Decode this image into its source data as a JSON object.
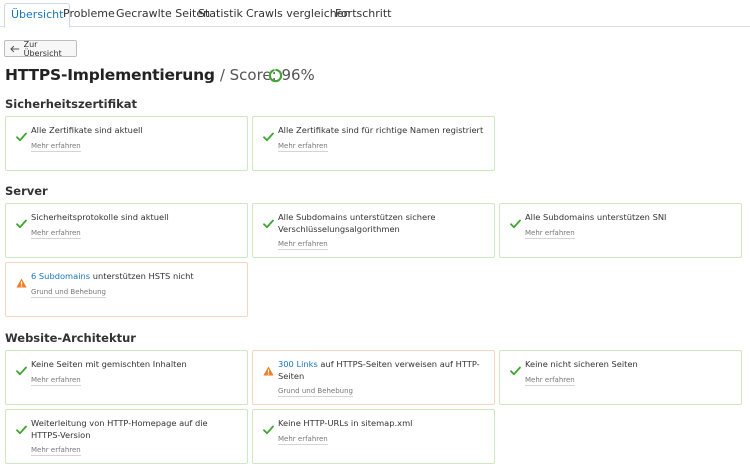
{
  "tabs": [
    "Übersicht",
    "Probleme",
    "Gecrawlte Seiten",
    "Statistik",
    "Crawls vergleichen",
    "Fortschritt"
  ],
  "back_label": "Zur Übersicht",
  "title": "HTTPS-Implementierung",
  "score_text": "/ Score: 96%",
  "score_value": 96,
  "colors": {
    "ok": "#3da530",
    "warn": "#f07e25",
    "link": "#1a75bb"
  },
  "sections": {
    "cert": {
      "title": "Sicherheitszertifikat",
      "cards": [
        {
          "status": "ok",
          "text": "Alle Zertifikate sind aktuell",
          "more": "Mehr erfahren"
        },
        {
          "status": "ok",
          "text": "Alle Zertifikate sind für richtige Namen registriert",
          "more": "Mehr erfahren"
        }
      ]
    },
    "server": {
      "title": "Server",
      "cards": [
        {
          "status": "ok",
          "text": "Sicherheitsprotokolle sind aktuell",
          "more": "Mehr erfahren"
        },
        {
          "status": "ok",
          "text": "Alle Subdomains unterstützen sichere Verschlüsselungsalgorithmen",
          "more": "Mehr erfahren"
        },
        {
          "status": "ok",
          "text": "Alle Subdomains unterstützen SNI",
          "more": "Mehr erfahren"
        },
        {
          "status": "warn",
          "link": "6 Subdomains",
          "text": " unterstützen HSTS nicht",
          "more": "Grund und Behebung"
        }
      ]
    },
    "arch": {
      "title": "Website-Architektur",
      "cards": [
        {
          "status": "ok",
          "text": "Keine Seiten mit gemischten Inhalten",
          "more": "Mehr erfahren"
        },
        {
          "status": "warn",
          "link": "300 Links",
          "text": " auf HTTPS-Seiten verweisen auf HTTP-Seiten",
          "more": "Grund und Behebung"
        },
        {
          "status": "ok",
          "text": "Keine nicht sicheren Seiten",
          "more": "Mehr erfahren"
        },
        {
          "status": "ok",
          "text": "Weiterleitung von HTTP-Homepage auf die HTTPS-Version",
          "more": "Mehr erfahren"
        },
        {
          "status": "ok",
          "text": "Keine HTTP-URLs in sitemap.xml",
          "more": "Mehr erfahren"
        }
      ]
    }
  }
}
